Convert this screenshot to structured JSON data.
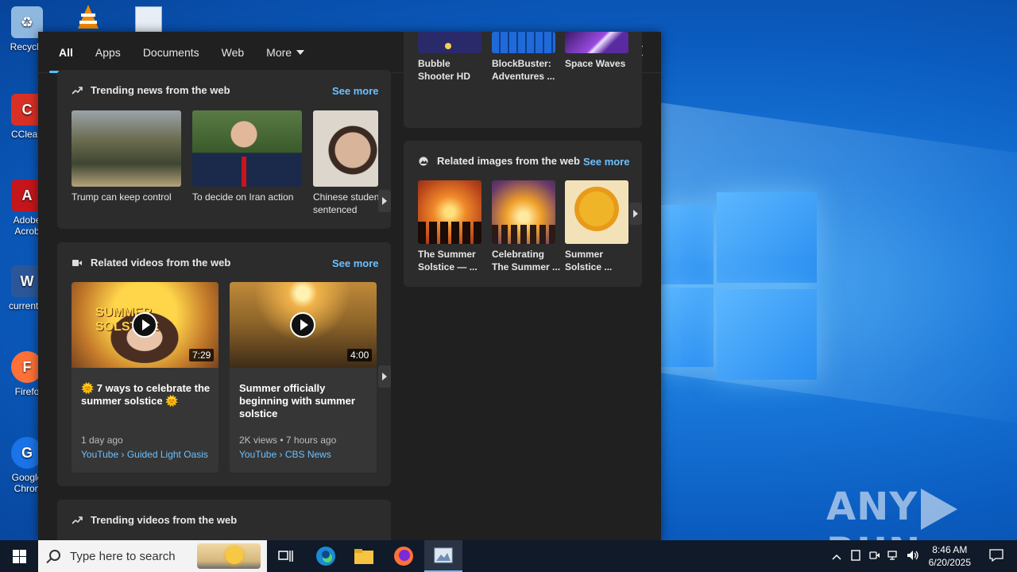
{
  "desktop": {
    "icons": [
      {
        "label": "Recycle",
        "color": "#4a90d9",
        "glyph": "♻"
      },
      {
        "label": "CClean",
        "color": "#d93025",
        "glyph": "C"
      },
      {
        "label": "Adobe Acrob",
        "color": "#c4161c",
        "glyph": "A"
      },
      {
        "label": "currently",
        "color": "#2b579a",
        "glyph": "W"
      },
      {
        "label": "Firefo",
        "color": "#ff7139",
        "glyph": "F"
      },
      {
        "label": "Google Chron",
        "color": "#1a73e8",
        "glyph": "G"
      }
    ],
    "watermark": {
      "left": "ANY",
      "right": "RUN"
    }
  },
  "flyout": {
    "tabs": [
      "All",
      "Apps",
      "Documents",
      "Web",
      "More"
    ],
    "active_tab": "All",
    "menu_dots": "···",
    "trending_news": {
      "title": "Trending news from the web",
      "see_more": "See more",
      "items": [
        {
          "caption": "Trump can keep control",
          "colors": [
            "#8a7a5a",
            "#4e5a3e",
            "#b9a88a"
          ]
        },
        {
          "caption": "To decide on Iran action",
          "colors": [
            "#3d5a2e",
            "#1b2a4a",
            "#d8c4b0"
          ]
        },
        {
          "caption": "Chinese studen sentenced",
          "colors": [
            "#d9d2c8",
            "#6e5a4c",
            "#efe8e0"
          ]
        }
      ]
    },
    "related_videos": {
      "title": "Related videos from the web",
      "see_more": "See more",
      "items": [
        {
          "duration": "7:29",
          "title": "🌞 7 ways to celebrate the summer solstice 🌞",
          "meta": "1 day ago",
          "source": "YouTube › Guided Light Oasis",
          "overlay": "SUMMER SOLSTICE"
        },
        {
          "duration": "4:00",
          "title": "Summer officially beginning with summer solstice",
          "meta": "2K views • 7 hours ago",
          "source": "YouTube › CBS News"
        }
      ]
    },
    "trending_videos": {
      "title": "Trending videos from the web"
    },
    "games": {
      "items": [
        {
          "caption": "Bubble Shooter HD"
        },
        {
          "caption": "BlockBuster: Adventures ..."
        },
        {
          "caption": "Space Waves"
        }
      ]
    },
    "related_images": {
      "title": "Related images from the web",
      "see_more": "See more",
      "items": [
        {
          "caption": "The Summer Solstice — ..."
        },
        {
          "caption": "Celebrating The Summer ..."
        },
        {
          "caption": "Summer Solstice ..."
        }
      ]
    }
  },
  "taskbar": {
    "search_placeholder": "Type here to search",
    "time": "8:46 AM",
    "date": "6/20/2025"
  }
}
